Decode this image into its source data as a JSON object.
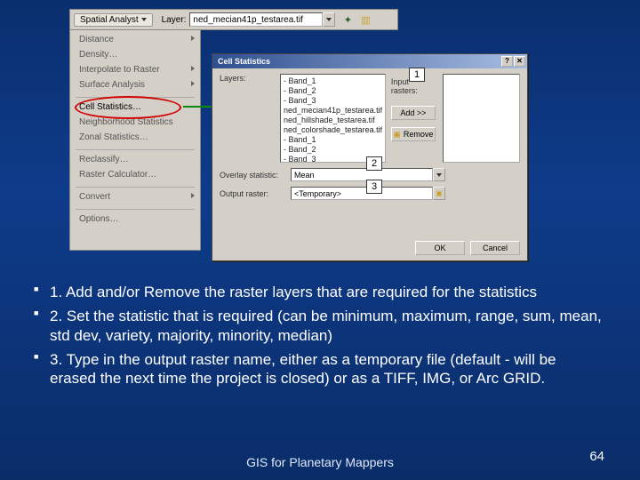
{
  "toolbar": {
    "button_label": "Spatial Analyst",
    "layer_label": "Layer:",
    "layer_value": "ned_mecian41p_testarea.tif"
  },
  "menu": {
    "items": [
      "Distance",
      "Density…",
      "Interpolate to Raster",
      "Surface Analysis",
      "Cell Statistics…",
      "Neighborhood Statistics",
      "Zonal Statistics…",
      "Reclassify…",
      "Raster Calculator…",
      "Convert",
      "Options…"
    ]
  },
  "dialog": {
    "title": "Cell Statistics",
    "layers_label": "Layers:",
    "input_rasters_label": "Input rasters:",
    "add_label": "Add >>",
    "remove_label": "Remove",
    "layers_list": [
      "- Band_1",
      "- Band_2",
      "- Band_3",
      "ned_mecian41p_testarea.tif",
      "ned_hillshade_testarea.tif",
      "ned_colorshade_testarea.tif",
      "- Band_1",
      "- Band_2",
      "- Band_3"
    ],
    "overlay_label": "Overlay statistic:",
    "overlay_value": "Mean",
    "output_label": "Output raster:",
    "output_value": "<Temporary>",
    "ok_label": "OK",
    "cancel_label": "Cancel"
  },
  "callouts": {
    "c1": "1",
    "c2": "2",
    "c3": "3"
  },
  "bullets": {
    "b1": "1. Add and/or Remove the raster layers that are required for the statistics",
    "b2": "2. Set the statistic that is required (can be minimum, maximum, range, sum, mean, std dev, variety, majority, minority, median)",
    "b3": "3. Type in the output raster name, either as a temporary file (default - will be erased the next time the project is closed) or as a TIFF, IMG, or Arc GRID."
  },
  "footer": "GIS for Planetary Mappers",
  "page_number": "64"
}
